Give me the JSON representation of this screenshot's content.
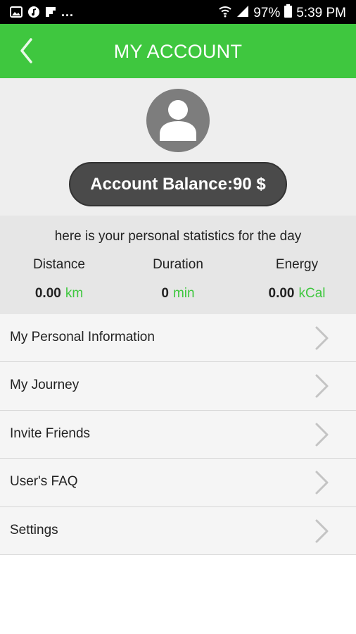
{
  "status_bar": {
    "overflow": "...",
    "battery": "97%",
    "time": "5:39 PM",
    "icons": [
      "image-icon",
      "music-icon",
      "flipboard-icon",
      "wifi-icon",
      "signal-icon",
      "battery-icon"
    ]
  },
  "header": {
    "title": "MY ACCOUNT",
    "back_icon": "chevron-left-icon",
    "color": "#3fc73f"
  },
  "profile": {
    "avatar_icon": "user-avatar-icon",
    "balance": "Account Balance:90 $"
  },
  "stats": {
    "caption": "here is your personal statistics for the day",
    "items": [
      {
        "label": "Distance",
        "value": "0.00",
        "unit": "km"
      },
      {
        "label": "Duration",
        "value": "0",
        "unit": "min"
      },
      {
        "label": "Energy",
        "value": "0.00",
        "unit": "kCal"
      }
    ]
  },
  "menu": {
    "items": [
      {
        "label": "My Personal Information"
      },
      {
        "label": "My Journey"
      },
      {
        "label": "Invite Friends"
      },
      {
        "label": "User's FAQ"
      },
      {
        "label": "Settings"
      }
    ],
    "chevron_icon": "chevron-right-icon"
  }
}
